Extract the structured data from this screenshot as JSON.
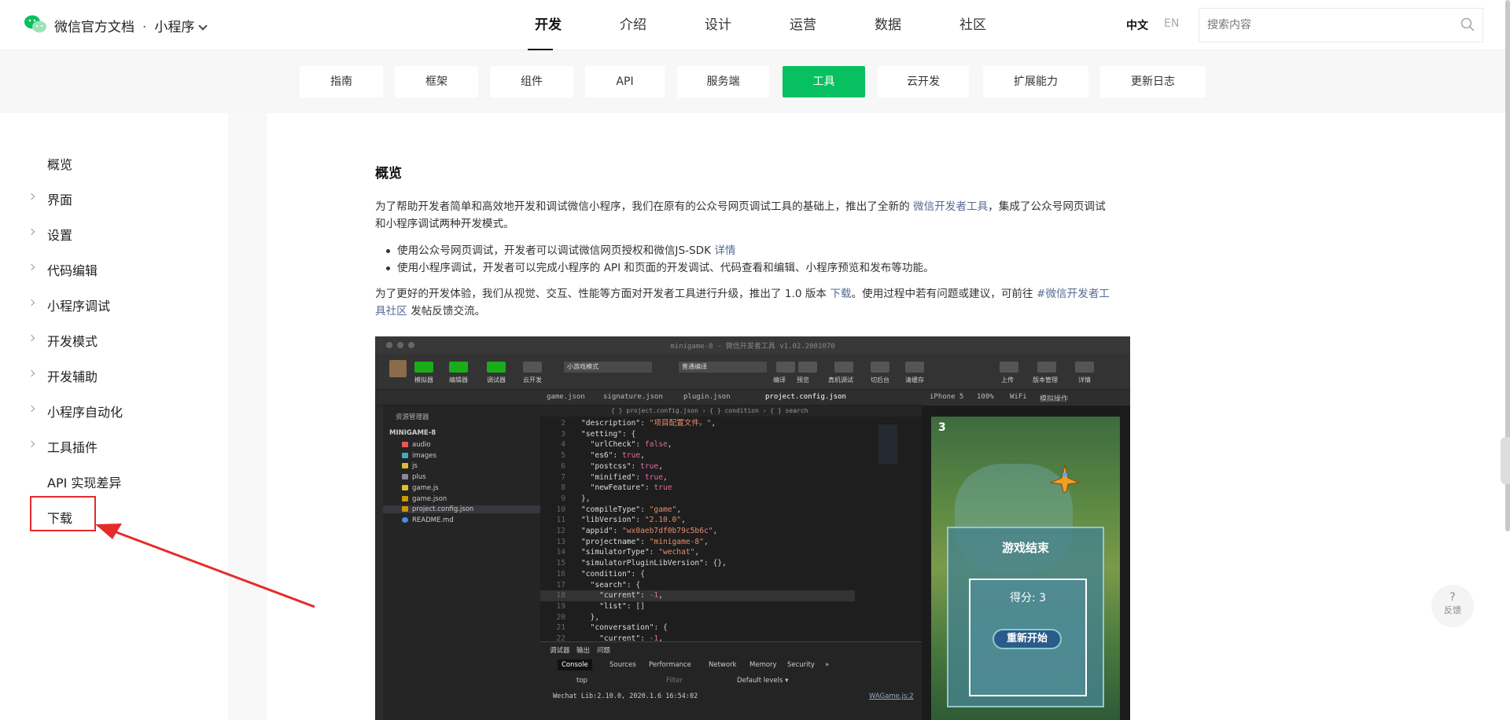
{
  "header": {
    "brand": "微信官方文档",
    "product": "小程序",
    "nav": [
      "开发",
      "介绍",
      "设计",
      "运营",
      "数据",
      "社区"
    ],
    "active_nav": "开发",
    "lang_zh": "中文",
    "lang_en": "EN",
    "search_placeholder": "搜索内容"
  },
  "subnav": [
    "指南",
    "框架",
    "组件",
    "API",
    "服务端",
    "工具",
    "云开发",
    "扩展能力",
    "更新日志"
  ],
  "subnav_active": "工具",
  "sidebar": {
    "items": [
      "概览",
      "界面",
      "设置",
      "代码编辑",
      "小程序调试",
      "开发模式",
      "开发辅助",
      "小程序自动化",
      "工具插件",
      "API 实现差异",
      "下载"
    ]
  },
  "content": {
    "title": "概览",
    "p1_a": "为了帮助开发者简单和高效地开发和调试微信小程序，我们在原有的公众号网页调试工具的基础上，推出了全新的 ",
    "p1_link": "微信开发者工具",
    "p1_b": "，集成了公众号网页调试",
    "p1_c": "和小程序调试两种开发模式。",
    "bullet1": "使用公众号网页调试，开发者可以调试微信网页授权和微信JS-SDK ",
    "bullet1_link": "详情",
    "bullet2": "使用小程序调试，开发者可以完成小程序的 API 和页面的开发调试、代码查看和编辑、小程序预览和发布等功能。",
    "p2_a": "为了更好的开发体验，我们从视觉、交互、性能等方面对开发者工具进行升级，推出了 1.0 版本 ",
    "p2_link1": "下载",
    "p2_b": "。使用过程中若有问题或建议，可前往 ",
    "p2_link2a": "#微信开发者工",
    "p2_link2b": "具社区",
    "p2_c": " 发帖反馈交流。"
  },
  "screenshot": {
    "window_title": "minigame-8 - 微信开发者工具 v1.02.2001070",
    "toolbar_left": [
      "模拟器",
      "编辑器",
      "调试器",
      "云开发"
    ],
    "mode_select": "小游戏模式",
    "compile_select": "普通编译",
    "toolbar_mid": [
      "编译",
      "预览",
      "真机调试",
      "切后台",
      "清缓存"
    ],
    "toolbar_right": [
      "上传",
      "版本管理",
      "详情"
    ],
    "file_tabs": [
      "game.json",
      "signature.json",
      "plugin.json",
      "project.config.json"
    ],
    "breadcrumb": "{ } project.config.json › { } condition › { } search",
    "sim_header": [
      "iPhone 5",
      "100%",
      "WiFi",
      "模拟操作"
    ],
    "explorer_title": "资源管理器",
    "explorer": [
      "MINIGAME-8",
      "audio",
      "images",
      "js",
      "plus",
      "game.js",
      "game.json",
      "project.config.json",
      "README.md"
    ],
    "code": [
      [
        "2",
        "\"description\": \"项目配置文件。\","
      ],
      [
        "3",
        "\"setting\": {"
      ],
      [
        "4",
        "  \"urlCheck\": false,"
      ],
      [
        "5",
        "  \"es6\": true,"
      ],
      [
        "6",
        "  \"postcss\": true,"
      ],
      [
        "7",
        "  \"minified\": true,"
      ],
      [
        "8",
        "  \"newFeature\": true"
      ],
      [
        "9",
        "},"
      ],
      [
        "10",
        "\"compileType\": \"game\","
      ],
      [
        "11",
        "\"libVersion\": \"2.10.0\","
      ],
      [
        "12",
        "\"appid\": \"wx0aeb7df0b79c5b6c\","
      ],
      [
        "13",
        "\"projectname\": \"minigame-8\","
      ],
      [
        "14",
        "\"simulatorType\": \"wechat\","
      ],
      [
        "15",
        "\"simulatorPluginLibVersion\": {},"
      ],
      [
        "16",
        "\"condition\": {"
      ],
      [
        "17",
        "  \"search\": {"
      ],
      [
        "18",
        "    \"current\": -1,"
      ],
      [
        "19",
        "    \"list\": []"
      ],
      [
        "20",
        "  },"
      ],
      [
        "21",
        "  \"conversation\": {"
      ],
      [
        "22",
        "    \"current\": -1,"
      ]
    ],
    "console_tabs": [
      "调试器",
      "输出",
      "问题"
    ],
    "devtools_tabs": [
      "Console",
      "Sources",
      "Performance",
      "Network",
      "Memory",
      "Security",
      "»"
    ],
    "console_context": "top",
    "console_filter": "Filter",
    "console_levels": "Default levels ▾",
    "console_log": "Wechat Lib:2.10.0, 2020.1.6 16:54:02",
    "console_src": "WAGame.js:2",
    "game_score": "3",
    "game_over": "游戏结束",
    "game_points": "得分: 3",
    "game_restart": "重新开始"
  },
  "feedback": {
    "q": "?",
    "label": "反馈"
  },
  "colors": {
    "accent": "#07c160",
    "link": "#576b95",
    "annotation": "#e52b2b"
  }
}
